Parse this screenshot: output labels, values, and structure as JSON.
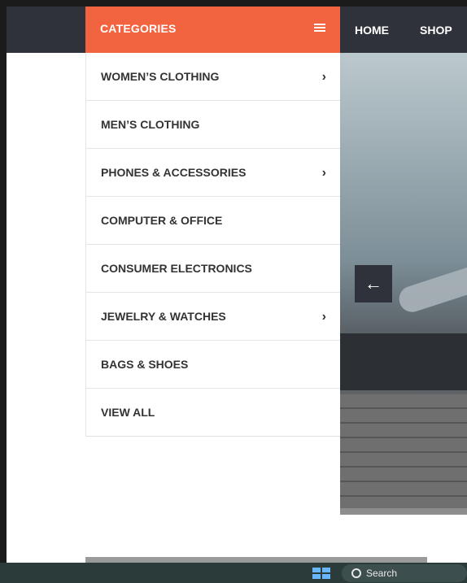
{
  "header": {
    "categories_label": "CATEGORIES",
    "nav": [
      {
        "label": "HOME"
      },
      {
        "label": "SHOP"
      }
    ]
  },
  "menu": {
    "items": [
      {
        "label": "WOMEN’S CLOTHING",
        "has_chevron": true
      },
      {
        "label": "MEN’S CLOTHING",
        "has_chevron": false
      },
      {
        "label": "PHONES & ACCESSORIES",
        "has_chevron": true
      },
      {
        "label": "COMPUTER & OFFICE",
        "has_chevron": false
      },
      {
        "label": "CONSUMER ELECTRONICS",
        "has_chevron": false
      },
      {
        "label": "JEWELRY & WATCHES",
        "has_chevron": true
      },
      {
        "label": "BAGS & SHOES",
        "has_chevron": false
      },
      {
        "label": "VIEW ALL",
        "has_chevron": false
      }
    ]
  },
  "carousel": {
    "prev_arrow": "←"
  },
  "taskbar": {
    "search_label": "Search"
  },
  "colors": {
    "accent": "#f2643f",
    "navbar": "#2f323a"
  }
}
